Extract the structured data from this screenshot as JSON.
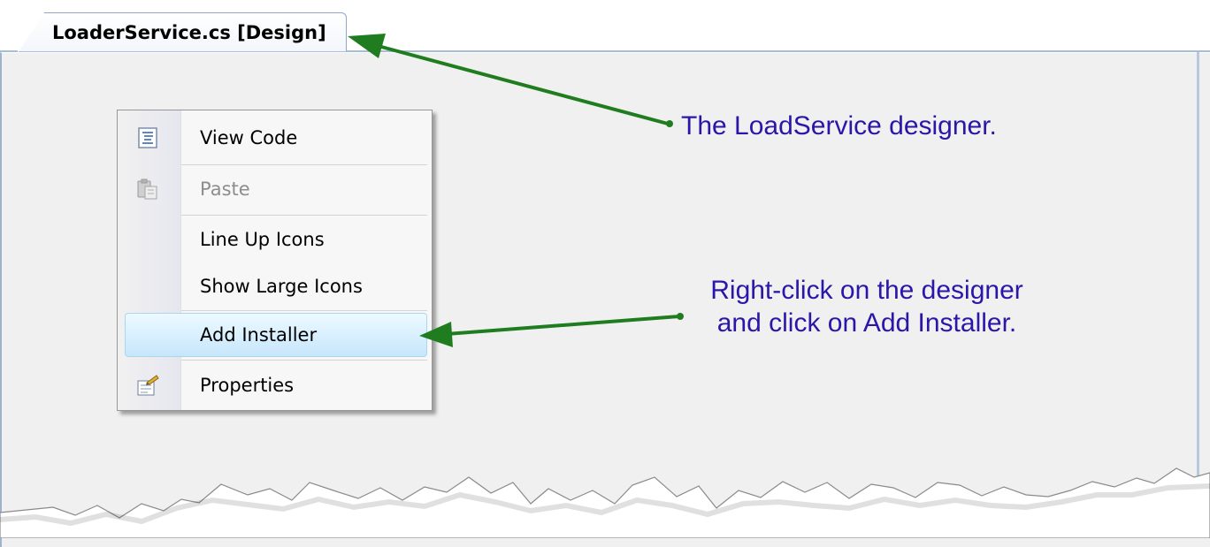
{
  "window": {
    "tab_title": "LoaderService.cs [Design]"
  },
  "context_menu": {
    "items": [
      {
        "label": "View Code",
        "icon": "view-code-icon",
        "enabled": true
      },
      {
        "label": "Paste",
        "icon": "paste-icon",
        "enabled": false
      },
      {
        "label": "Line Up Icons",
        "icon": "",
        "enabled": true
      },
      {
        "label": "Show Large Icons",
        "icon": "",
        "enabled": true
      },
      {
        "label": "Add Installer",
        "icon": "",
        "enabled": true,
        "highlighted": true
      },
      {
        "label": "Properties",
        "icon": "properties-icon",
        "enabled": true
      }
    ]
  },
  "annotations": {
    "designer_callout": "The LoadService designer.",
    "installer_callout_line1": "Right-click on the designer",
    "installer_callout_line2": "and click on Add Installer."
  },
  "colors": {
    "callout_text": "#2a16a8",
    "arrow": "#1f7d1f",
    "menu_highlight": "#d7efff",
    "surface": "#f0f0f0"
  }
}
